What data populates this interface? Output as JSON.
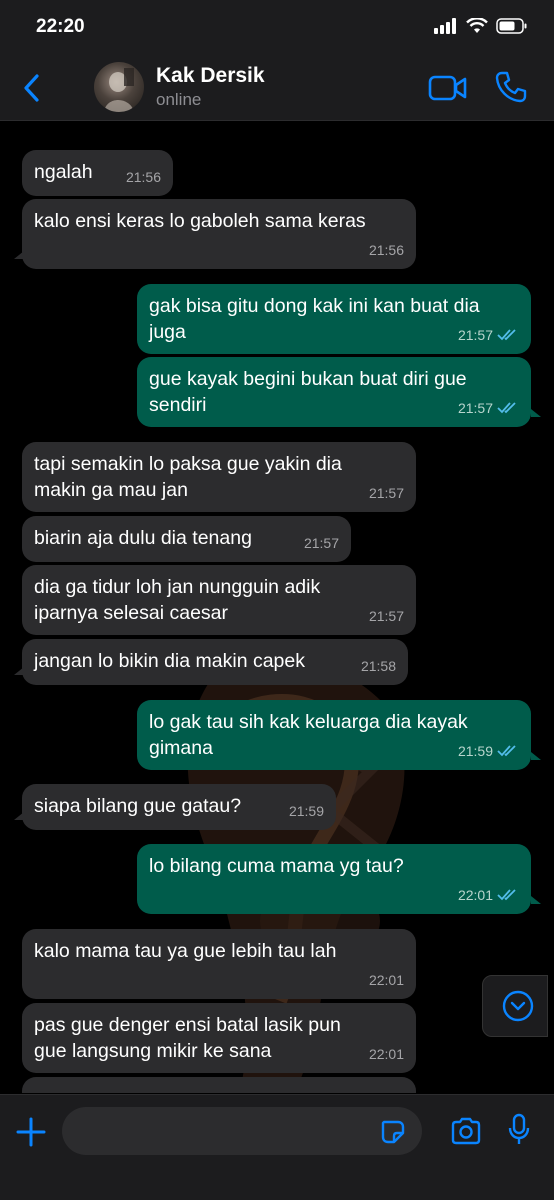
{
  "status_bar": {
    "time": "22:20"
  },
  "header": {
    "contact_name": "Kak Dersik",
    "status": "online"
  },
  "messages": [
    {
      "text": "ngalah",
      "time": "21:56",
      "dir": "in"
    },
    {
      "text": "kalo ensi keras lo gaboleh sama keras",
      "time": "21:56",
      "dir": "in"
    },
    {
      "line1": "gak bisa gitu dong kak ini kan buat dia",
      "line2": "juga",
      "time": "21:57",
      "dir": "out"
    },
    {
      "line1": "gue kayak begini bukan buat diri gue",
      "line2": "sendiri",
      "time": "21:57",
      "dir": "out"
    },
    {
      "line1": "tapi semakin lo paksa gue yakin dia",
      "line2": "makin ga mau jan",
      "time": "21:57",
      "dir": "in"
    },
    {
      "text": "biarin aja dulu dia tenang",
      "time": "21:57",
      "dir": "in"
    },
    {
      "line1": "dia ga tidur loh jan nungguin adik",
      "line2": "iparnya selesai caesar",
      "time": "21:57",
      "dir": "in"
    },
    {
      "text": "jangan lo bikin dia makin capek",
      "time": "21:58",
      "dir": "in"
    },
    {
      "line1": "lo gak tau sih kak keluarga dia kayak",
      "line2": "gimana",
      "time": "21:59",
      "dir": "out"
    },
    {
      "text": "siapa bilang gue gatau?",
      "time": "21:59",
      "dir": "in"
    },
    {
      "text": "lo bilang cuma mama yg tau?",
      "time": "22:01",
      "dir": "out"
    },
    {
      "text": "kalo mama tau ya gue lebih tau lah",
      "time": "22:01",
      "dir": "in"
    },
    {
      "line1": "pas gue denger ensi batal lasik pun",
      "line2": "gue langsung mikir ke sana",
      "time": "22:01",
      "dir": "in"
    }
  ],
  "colors": {
    "accent": "#0a84ff",
    "incoming_bubble": "#2c2c2e",
    "outgoing_bubble": "#005c4b",
    "read_ticks": "#53bdeb"
  }
}
